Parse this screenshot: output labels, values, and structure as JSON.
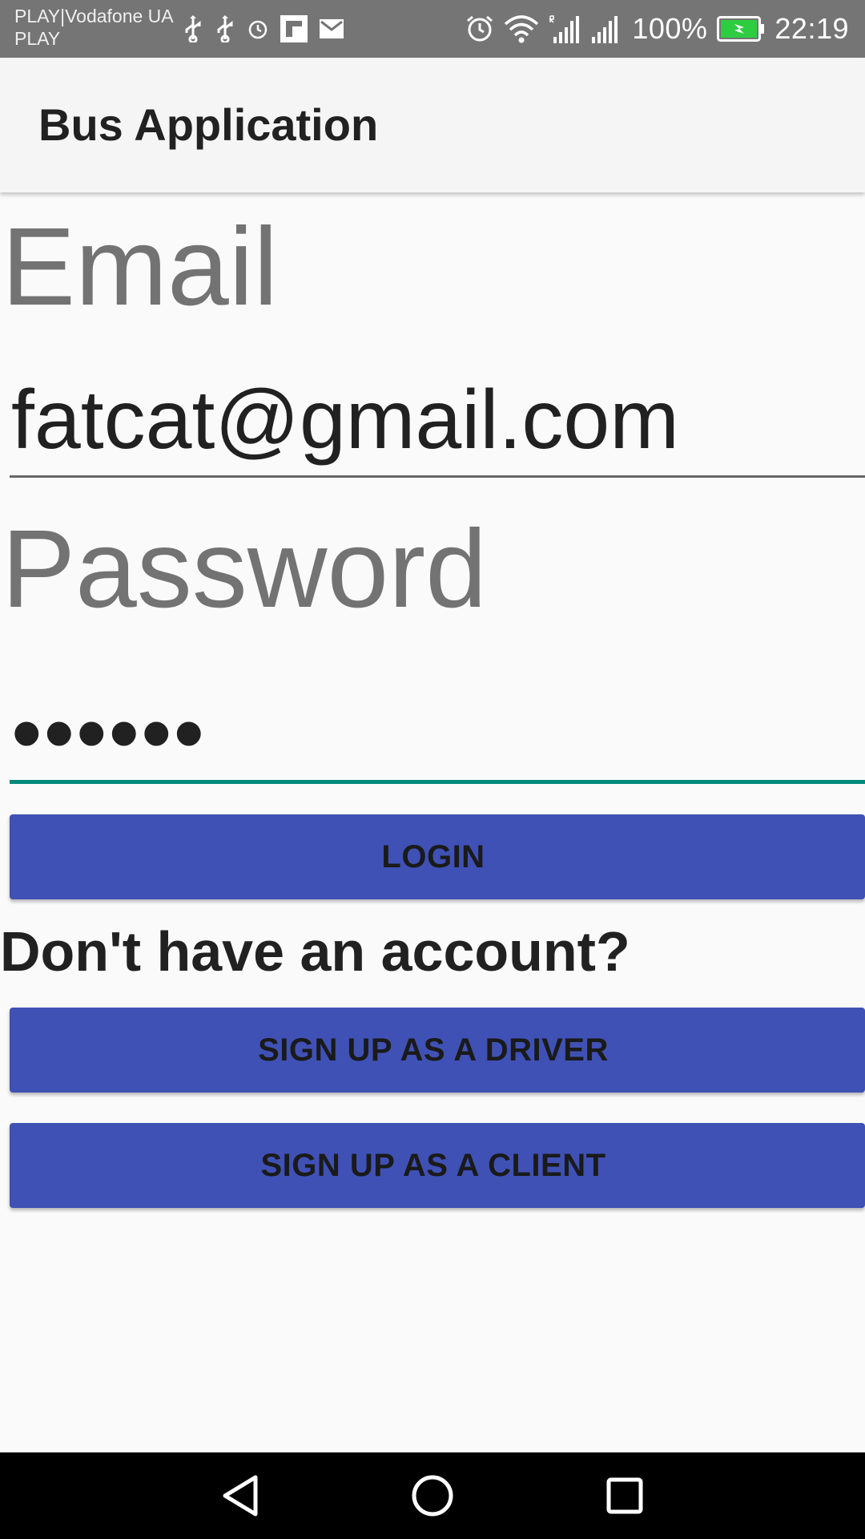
{
  "status_bar": {
    "carrier_line1": "PLAY|Vodafone UA",
    "carrier_line2": "PLAY",
    "left_icons": [
      "usb-icon",
      "usb-icon",
      "alarm-icon",
      "flipboard-icon",
      "gmail-icon"
    ],
    "right_icons": [
      "alarm-icon",
      "wifi-icon",
      "signal-roaming-icon",
      "signal-icon",
      "battery-charging-icon"
    ],
    "battery": "100%",
    "time": "22:19",
    "battery_color": "#2ecc40"
  },
  "app_bar": {
    "title": "Bus Application"
  },
  "form": {
    "email_label": "Email",
    "email_value": "fatcat@gmail.com",
    "password_label": "Password",
    "password_value": "••••••",
    "login_label": "LOGIN",
    "no_account_text": "Don't have an account?",
    "signup_driver_label": "SIGN UP AS A DRIVER",
    "signup_client_label": "SIGN UP AS A CLIENT"
  },
  "colors": {
    "primary": "#3f51b5",
    "accent": "#00897b",
    "status_bar": "#757575"
  },
  "nav_bar": {
    "icons": [
      "back-icon",
      "home-icon",
      "recent-apps-icon"
    ]
  }
}
